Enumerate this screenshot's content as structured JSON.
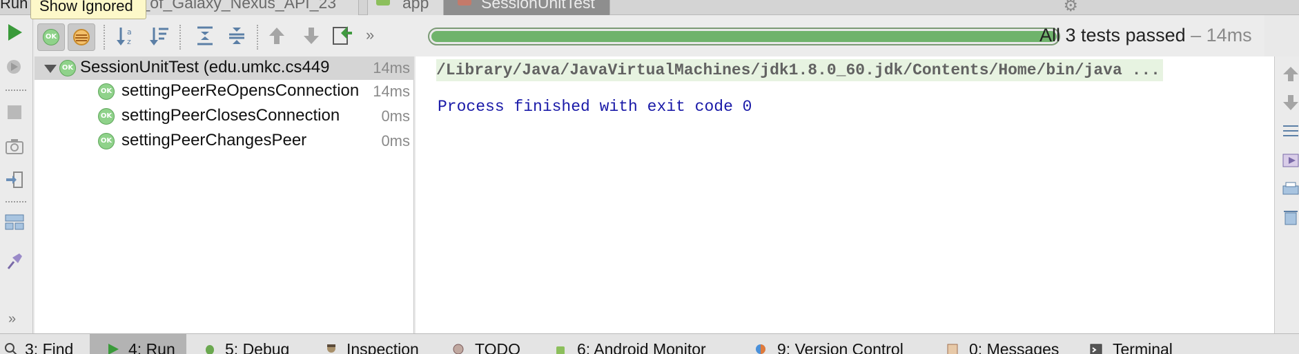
{
  "top_tabs": {
    "run_label": "Run",
    "tooltip": "Show Ignored",
    "tabs": [
      {
        "label": "y_of_Galaxy_Nexus_API_23"
      },
      {
        "label": "app"
      },
      {
        "label": "SessionUnitTest"
      }
    ]
  },
  "toolbar": {
    "more": "»",
    "progress_fraction": 1.0,
    "status_text": "All 3 tests passed",
    "status_duration": "– 14ms"
  },
  "tree": {
    "ok_badge": "OK",
    "root": {
      "name": "SessionUnitTest (edu.umkc.cs449",
      "time": "14ms"
    },
    "tests": [
      {
        "name": "settingPeerReOpensConnection",
        "time": "14ms"
      },
      {
        "name": "settingPeerClosesConnection",
        "time": "0ms"
      },
      {
        "name": "settingPeerChangesPeer",
        "time": "0ms"
      }
    ]
  },
  "console": {
    "command": "/Library/Java/JavaVirtualMachines/jdk1.8.0_60.jdk/Contents/Home/bin/java ...",
    "exit_message": "Process finished with exit code 0"
  },
  "left_bar": {
    "more": "»"
  },
  "bottom_tabs": [
    {
      "label": "3: Find"
    },
    {
      "label": "4: Run"
    },
    {
      "label": "5: Debug"
    },
    {
      "label": "Inspection"
    },
    {
      "label": "TODO"
    },
    {
      "label": "6: Android Monitor"
    },
    {
      "label": "9: Version Control"
    },
    {
      "label": "0: Messages"
    },
    {
      "label": "Terminal"
    }
  ],
  "colors": {
    "pass_green": "#6fb36b",
    "console_blue": "#1a1aa8",
    "tooltip_bg": "#fdf8c9"
  }
}
